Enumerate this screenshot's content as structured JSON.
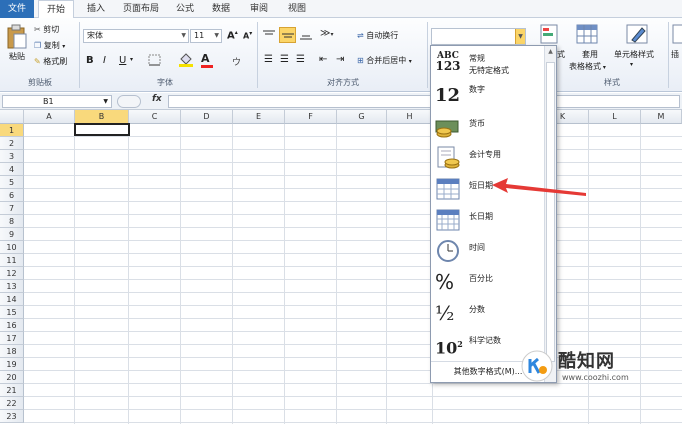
{
  "menu": {
    "tabs": [
      "文件",
      "开始",
      "插入",
      "页面布局",
      "公式",
      "数据",
      "审阅",
      "视图"
    ]
  },
  "clipboard": {
    "paste": "粘贴",
    "cut": "剪切",
    "copy": "复制",
    "format_painter": "格式刷",
    "group": "剪贴板"
  },
  "font": {
    "name": "宋体",
    "size": "11",
    "bold": "B",
    "italic": "I",
    "underline": "U",
    "grow": "A",
    "shrink": "A",
    "color_letter": "A",
    "phonetic": "ウ",
    "group": "字体"
  },
  "alignment": {
    "wrap": "自动换行",
    "merge": "合并后居中",
    "group": "对齐方式"
  },
  "number": {
    "combo_value": ""
  },
  "styles": {
    "cond_format": "式",
    "table_format_top": "套用",
    "table_format": "表格格式",
    "cell_style": "单元格样式",
    "group": "样式"
  },
  "cells": {
    "insert": "插"
  },
  "formula_bar": {
    "name_box": "B1",
    "fx": "fx",
    "value": ""
  },
  "columns": [
    "A",
    "B",
    "C",
    "D",
    "E",
    "F",
    "G",
    "H",
    "K",
    "L",
    "M"
  ],
  "rows": [
    "1",
    "2",
    "3",
    "4",
    "5",
    "6",
    "7",
    "8",
    "9",
    "10",
    "11",
    "12",
    "13",
    "14",
    "15",
    "16",
    "17",
    "18",
    "19",
    "20",
    "21",
    "22",
    "23"
  ],
  "dropdown": {
    "items": [
      {
        "icon": "general-format-icon",
        "glyph_top": "ABC",
        "glyph_bottom": "123",
        "label": "常规",
        "sub": "无特定格式"
      },
      {
        "icon": "number-format-icon",
        "glyph": "12",
        "label": "数字"
      },
      {
        "icon": "currency-format-icon",
        "label": "货币"
      },
      {
        "icon": "accounting-format-icon",
        "label": "会计专用"
      },
      {
        "icon": "short-date-icon",
        "label": "短日期"
      },
      {
        "icon": "long-date-icon",
        "label": "长日期"
      },
      {
        "icon": "clock-icon",
        "label": "时间"
      },
      {
        "icon": "percent-icon",
        "glyph": "%",
        "label": "百分比"
      },
      {
        "icon": "fraction-icon",
        "glyph": "½",
        "label": "分数"
      },
      {
        "icon": "scientific-icon",
        "glyph": "10",
        "sup": "2",
        "label": "科学记数"
      }
    ],
    "more": "其他数字格式(M)..."
  },
  "watermark": {
    "brand": "酷知网",
    "url": "www.coozhi.com"
  },
  "colors": {
    "accent": "#2c6fb8",
    "arrow": "#e53935",
    "selection": "#f9d97c"
  }
}
